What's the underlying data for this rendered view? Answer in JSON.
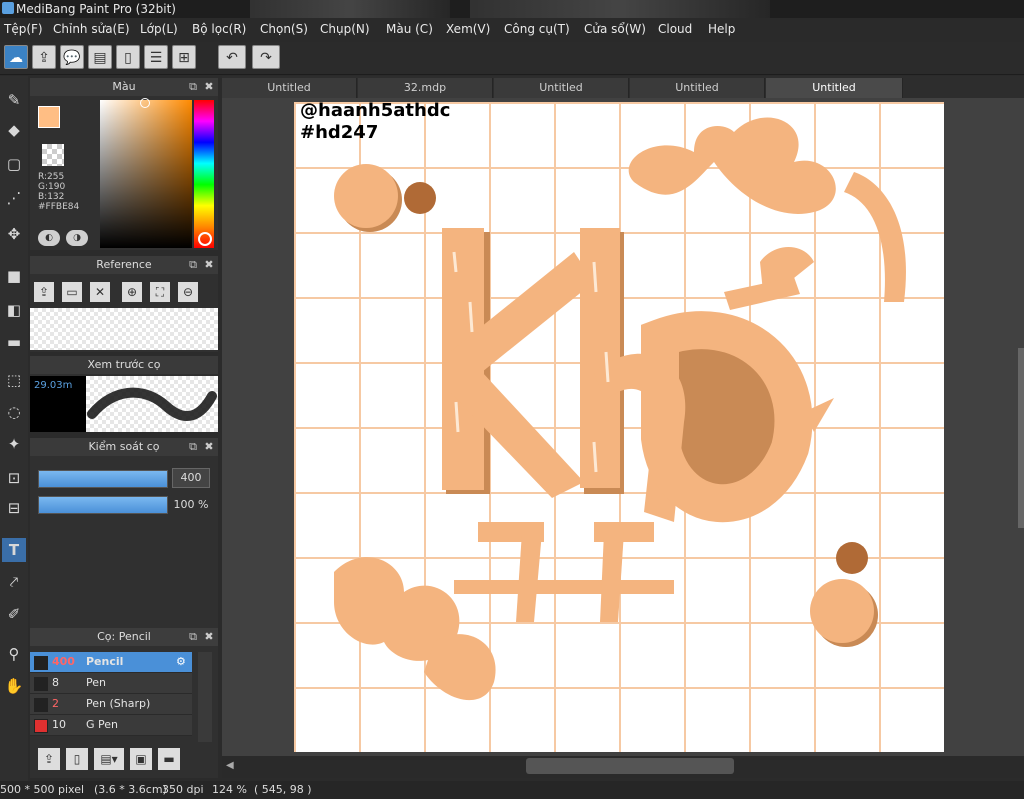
{
  "window": {
    "title": "MediBang Paint Pro (32bit)"
  },
  "menu": [
    "Tệp(F)",
    "Chỉnh sửa(E)",
    "Lớp(L)",
    "Bộ lọc(R)",
    "Chọn(S)",
    "Chụp(N)",
    "Màu (C)",
    "Xem(V)",
    "Công cụ(T)",
    "Cửa sổ(W)",
    "Cloud",
    "Help"
  ],
  "toolbar": {
    "icons": [
      "cloud-icon",
      "export-icon",
      "comment-icon",
      "comment-list-icon",
      "page-icon",
      "page-list-icon",
      "grid-plus-icon"
    ],
    "undo_icon": "undo-icon",
    "redo_icon": "redo-icon"
  },
  "tabs": [
    {
      "label": "Untitled",
      "active": false
    },
    {
      "label": "32.mdp",
      "active": false
    },
    {
      "label": "Untitled",
      "active": false
    },
    {
      "label": "Untitled",
      "active": false
    },
    {
      "label": "Untitled",
      "active": true
    }
  ],
  "color_panel": {
    "title": "Màu",
    "r": "R:255",
    "g": "G:190",
    "b": "B:132",
    "hex": "#FFBE84",
    "foreground": "#FFBE84"
  },
  "reference_panel": {
    "title": "Reference"
  },
  "brush_preview_panel": {
    "title": "Xem trước cọ",
    "size": "29.03m"
  },
  "brush_control_panel": {
    "title": "Kiểm soát cọ",
    "size_value": "400",
    "opacity_value": "100 %",
    "size_fill": 1.0,
    "opacity_fill": 1.0
  },
  "brush_list_panel": {
    "title": "Cọ: Pencil",
    "items": [
      {
        "size": "400",
        "name": "Pencil",
        "color": "#222222",
        "selected": true
      },
      {
        "size": "8",
        "name": "Pen",
        "color": "#222222",
        "selected": false
      },
      {
        "size": "2",
        "name": "Pen (Sharp)",
        "color": "#222222",
        "selected": false
      },
      {
        "size": "10",
        "name": "G Pen",
        "color": "#e03030",
        "selected": false
      }
    ]
  },
  "canvas": {
    "watermark_line1": "@haanh5athdc",
    "watermark_line2": "#hd247",
    "grid_color": "#f6c9a3",
    "art_color": "#f4b47f",
    "art_shadow": "#c98a55",
    "dot_color": "#b06a36"
  },
  "status": {
    "size": "500 * 500 pixel",
    "cm": "(3.6 * 3.6cm)",
    "dpi": "350 dpi",
    "zoom": "124 %",
    "coords": "( 545, 98 )"
  }
}
